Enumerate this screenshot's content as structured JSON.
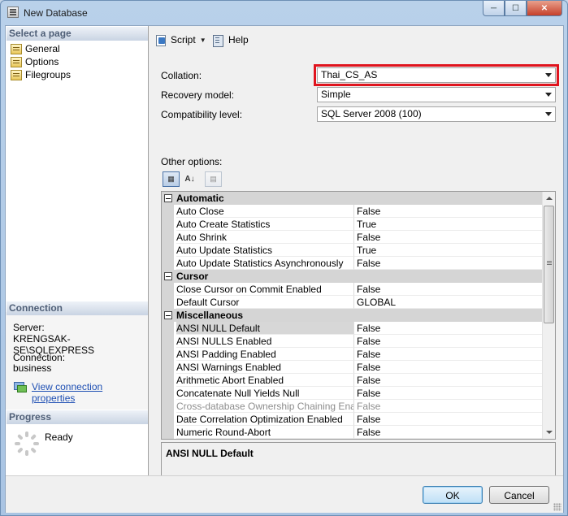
{
  "window": {
    "title": "New Database"
  },
  "left_pane": {
    "select_page_header": "Select a page",
    "pages": [
      {
        "label": "General",
        "icon": "page-icon"
      },
      {
        "label": "Options",
        "icon": "page-icon"
      },
      {
        "label": "Filegroups",
        "icon": "page-icon"
      }
    ],
    "connection_header": "Connection",
    "server_label": "Server:",
    "server_value": "KRENGSAK-SE\\SQLEXPRESS",
    "connection_label": "Connection:",
    "connection_value": "business",
    "view_connection_link": "View connection properties",
    "progress_header": "Progress",
    "progress_status": "Ready"
  },
  "toolbar": {
    "script_label": "Script",
    "help_label": "Help"
  },
  "options": {
    "collation_label": "Collation:",
    "collation_value": "Thai_CS_AS",
    "recovery_label": "Recovery model:",
    "recovery_value": "Simple",
    "compat_label": "Compatibility level:",
    "compat_value": "SQL Server 2008 (100)",
    "other_options_label": "Other options:"
  },
  "property_grid": {
    "rows": [
      {
        "type": "category",
        "label": "Automatic"
      },
      {
        "type": "property",
        "name": "Auto Close",
        "value": "False"
      },
      {
        "type": "property",
        "name": "Auto Create Statistics",
        "value": "True"
      },
      {
        "type": "property",
        "name": "Auto Shrink",
        "value": "False"
      },
      {
        "type": "property",
        "name": "Auto Update Statistics",
        "value": "True"
      },
      {
        "type": "property",
        "name": "Auto Update Statistics Asynchronously",
        "value": "False"
      },
      {
        "type": "category",
        "label": "Cursor"
      },
      {
        "type": "property",
        "name": "Close Cursor on Commit Enabled",
        "value": "False"
      },
      {
        "type": "property",
        "name": "Default Cursor",
        "value": "GLOBAL"
      },
      {
        "type": "category",
        "label": "Miscellaneous"
      },
      {
        "type": "property",
        "name": "ANSI NULL Default",
        "value": "False",
        "selected": true
      },
      {
        "type": "property",
        "name": "ANSI NULLS Enabled",
        "value": "False"
      },
      {
        "type": "property",
        "name": "ANSI Padding Enabled",
        "value": "False"
      },
      {
        "type": "property",
        "name": "ANSI Warnings Enabled",
        "value": "False"
      },
      {
        "type": "property",
        "name": "Arithmetic Abort Enabled",
        "value": "False"
      },
      {
        "type": "property",
        "name": "Concatenate Null Yields Null",
        "value": "False"
      },
      {
        "type": "property",
        "name": "Cross-database Ownership Chaining Enabled",
        "value": "False",
        "disabled": true
      },
      {
        "type": "property",
        "name": "Date Correlation Optimization Enabled",
        "value": "False"
      },
      {
        "type": "property",
        "name": "Numeric Round-Abort",
        "value": "False"
      }
    ],
    "description_title": "ANSI NULL Default"
  },
  "buttons": {
    "ok_label": "OK",
    "cancel_label": "Cancel"
  }
}
